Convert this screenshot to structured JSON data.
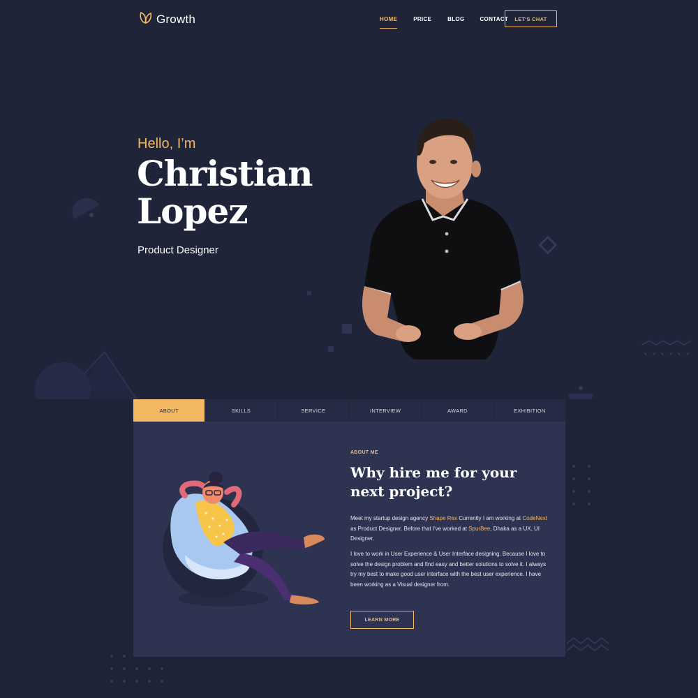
{
  "brand": {
    "logo_text": "Growth",
    "logo_icon": "leaf-icon",
    "accent_color": "#f5b862"
  },
  "nav": {
    "items": [
      {
        "label": "HOME",
        "active": true
      },
      {
        "label": "PRICE",
        "active": false
      },
      {
        "label": "BLOG",
        "active": false
      },
      {
        "label": "CONTACT",
        "active": false
      }
    ],
    "cta_label": "LET'S CHAT"
  },
  "hero": {
    "greeting": "Hello, I’m",
    "first_name": "Christian",
    "last_name": "Lopez",
    "role": "Product Designer"
  },
  "tabs": [
    {
      "label": "ABOUT",
      "active": true
    },
    {
      "label": "SKILLS",
      "active": false
    },
    {
      "label": "SERVICE",
      "active": false
    },
    {
      "label": "INTERVIEW",
      "active": false
    },
    {
      "label": "AWARD",
      "active": false
    },
    {
      "label": "EXHIBITION",
      "active": false
    }
  ],
  "about": {
    "label": "ABOUT ME",
    "title": "Why hire me for your next project?",
    "p1_a": "Meet my startup design agency ",
    "p1_link1": "Shape Rex",
    "p1_b": " Currently I am working at ",
    "p1_link2": "CodeNext",
    "p1_c": " as Product Designer. Before that I've worked at ",
    "p1_link3": "SpurBee",
    "p1_d": ", Dhaka as a UX, UI Designer.",
    "p2": "I love to work in User Experience & User Interface designing. Because I love to solve the design problem and find easy and better solutions to solve it. I always try my best to make good user interface with the best user experience. I have been working as a Visual designer from.",
    "button_label": "LEARN MORE"
  }
}
